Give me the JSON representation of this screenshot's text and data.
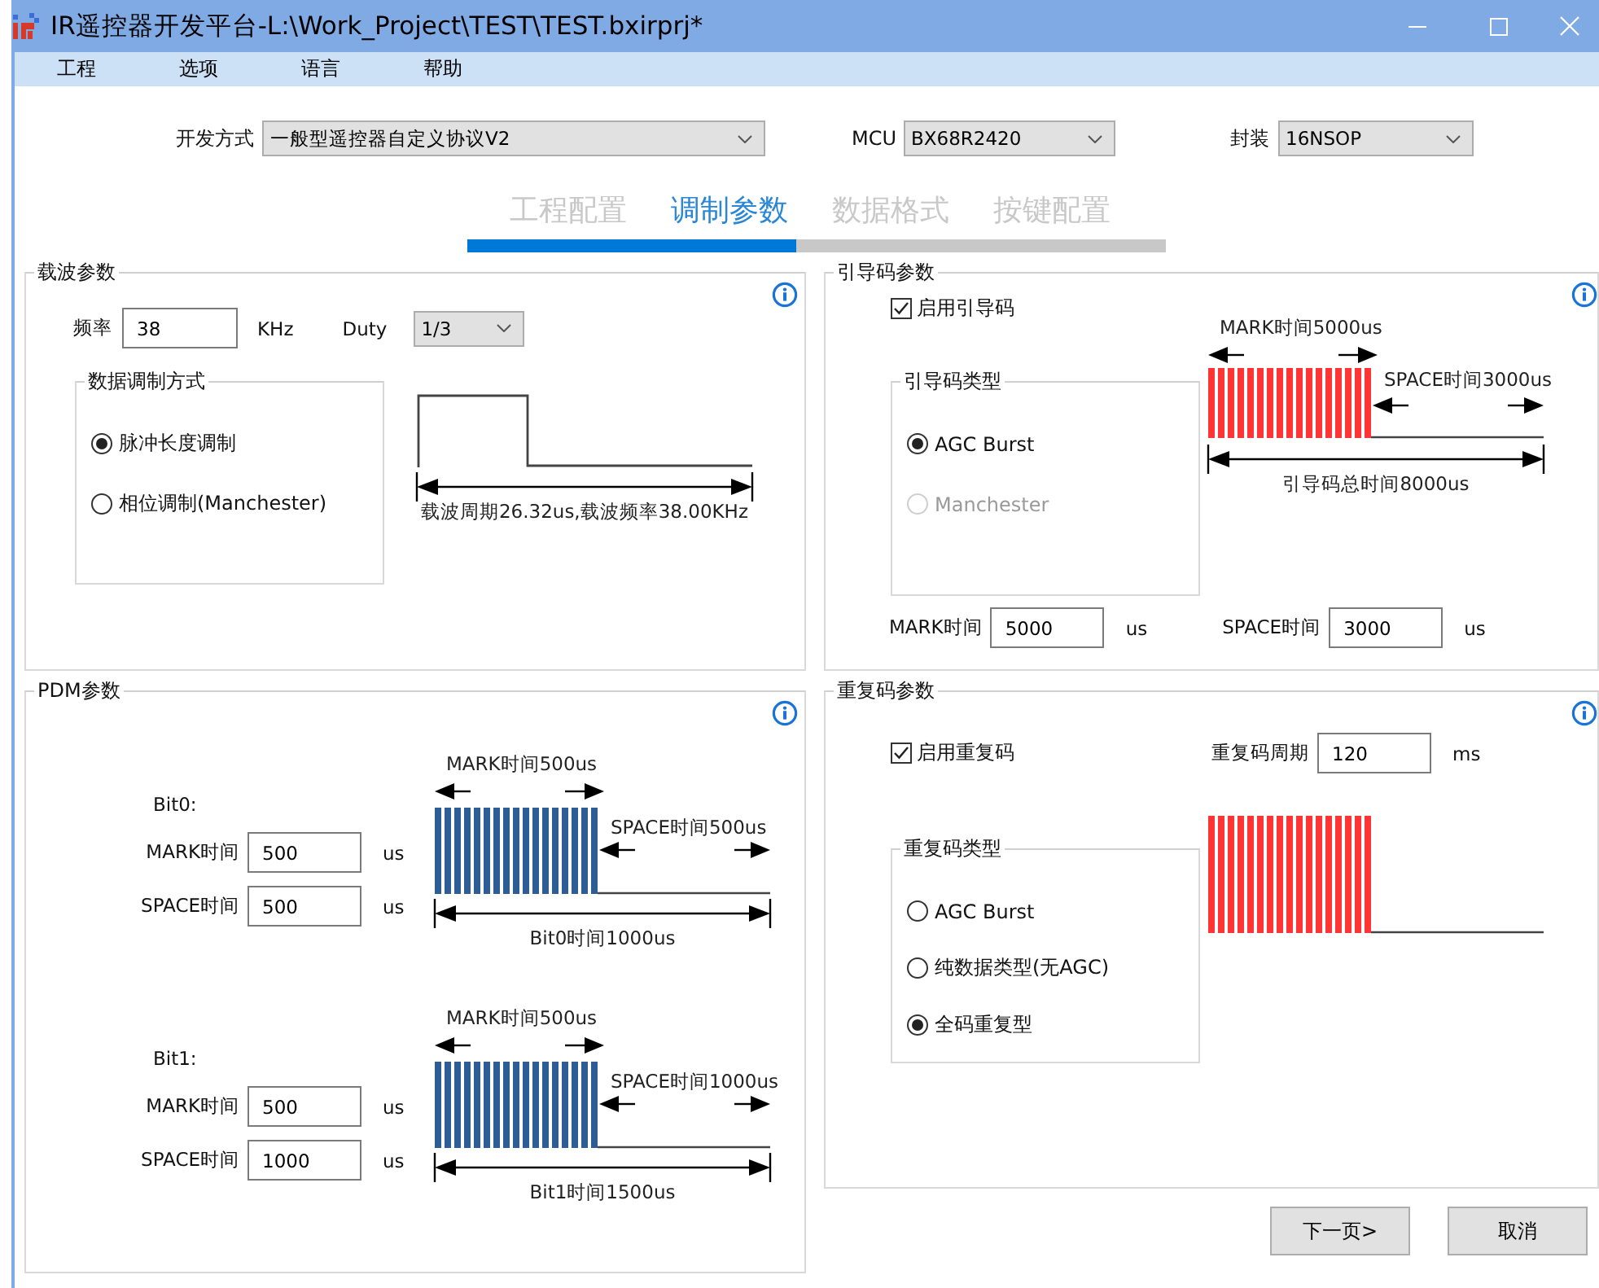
{
  "window": {
    "title": "IR遥控器开发平台-L:\\Work_Project\\TEST\\TEST.bxirprj*"
  },
  "menu": [
    {
      "label": "工程"
    },
    {
      "label": "选项"
    },
    {
      "label": "语言"
    },
    {
      "label": "帮助"
    }
  ],
  "settings": [
    {
      "label": "开发方式",
      "value": "一般型遥控器自定义协议V2"
    },
    {
      "label": "MCU",
      "value": "BX68R2420"
    },
    {
      "label": "封装",
      "value": "16NSOP"
    }
  ],
  "steps": [
    {
      "label": "工程配置",
      "selected": false
    },
    {
      "label": "调制参数",
      "selected": true
    },
    {
      "label": "数据格式",
      "selected": false
    },
    {
      "label": "按键配置",
      "selected": false
    }
  ],
  "progress": {
    "level": 0.47
  },
  "carrier": {
    "title": "载波参数",
    "frequency": {
      "label": "频率",
      "value": "38",
      "unit": "KHz"
    },
    "duty": {
      "label": "Duty",
      "value": "1/3"
    },
    "modulation": {
      "title": "数据调制方式",
      "options": [
        {
          "label": "脉冲长度调制",
          "selected": true,
          "disabled": false
        },
        {
          "label": "相位调制(Manchester)",
          "selected": false,
          "disabled": false
        }
      ]
    },
    "diagram": {
      "caption": "载波周期26.32us,载波频率38.00KHz"
    }
  },
  "leader": {
    "title": "引导码参数",
    "enable": {
      "label": "启用引导码",
      "checked": true
    },
    "type": {
      "title": "引导码类型",
      "options": [
        {
          "label": "AGC Burst",
          "selected": true,
          "disabled": false
        },
        {
          "label": "Manchester",
          "selected": false,
          "disabled": true
        }
      ]
    },
    "mark": {
      "label": "MARK时间",
      "value": "5000",
      "unit": "us"
    },
    "space": {
      "label": "SPACE时间",
      "value": "3000",
      "unit": "us"
    },
    "diagram": {
      "mark_label": "MARK时间5000us",
      "space_label": "SPACE时间3000us",
      "total_label": "引导码总时间8000us"
    }
  },
  "pdm": {
    "title": "PDM参数",
    "bits": [
      {
        "label": "Bit0:",
        "mark": {
          "label": "MARK时间",
          "value": "500",
          "unit": "us"
        },
        "space": {
          "label": "SPACE时间",
          "value": "500",
          "unit": "us"
        },
        "diagram": {
          "mark_label": "MARK时间500us",
          "space_label": "SPACE时间500us",
          "total_label": "Bit0时间1000us"
        }
      },
      {
        "label": "Bit1:",
        "mark": {
          "label": "MARK时间",
          "value": "500",
          "unit": "us"
        },
        "space": {
          "label": "SPACE时间",
          "value": "1000",
          "unit": "us"
        },
        "diagram": {
          "mark_label": "MARK时间500us",
          "space_label": "SPACE时间1000us",
          "total_label": "Bit1时间1500us"
        }
      }
    ]
  },
  "repeat": {
    "title": "重复码参数",
    "enable": {
      "label": "启用重复码",
      "checked": true
    },
    "period": {
      "label": "重复码周期",
      "value": "120",
      "unit": "ms"
    },
    "type": {
      "title": "重复码类型",
      "options": [
        {
          "label": "AGC Burst",
          "selected": false,
          "disabled": false
        },
        {
          "label": "纯数据类型(无AGC)",
          "selected": false,
          "disabled": false
        },
        {
          "label": "全码重复型",
          "selected": true,
          "disabled": false
        }
      ]
    }
  },
  "buttons": [
    {
      "label": "下一页>"
    },
    {
      "label": "取消"
    }
  ]
}
